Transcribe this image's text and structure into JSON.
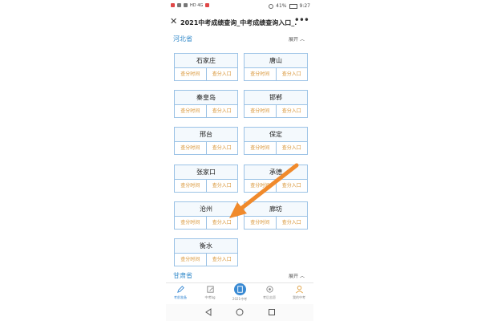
{
  "status_bar": {
    "left_text": "HD 4G",
    "battery": "41%",
    "time": "9:27"
  },
  "titlebar": {
    "title": "2021中考成绩查询_中考成绩查询入口_..."
  },
  "provinces": [
    {
      "name": "河北省",
      "expand_label": "展开",
      "cities": [
        {
          "name": "石家庄",
          "time_label": "查分时间",
          "entry_label": "查分入口"
        },
        {
          "name": "唐山",
          "time_label": "查分时间",
          "entry_label": "查分入口"
        },
        {
          "name": "秦皇岛",
          "time_label": "查分时间",
          "entry_label": "查分入口"
        },
        {
          "name": "邯郸",
          "time_label": "查分时间",
          "entry_label": "查分入口"
        },
        {
          "name": "邢台",
          "time_label": "查分时间",
          "entry_label": "查分入口"
        },
        {
          "name": "保定",
          "time_label": "查分时间",
          "entry_label": "查分入口"
        },
        {
          "name": "张家口",
          "time_label": "查分时间",
          "entry_label": "查分入口"
        },
        {
          "name": "承德",
          "time_label": "查分时间",
          "entry_label": "查分入口"
        },
        {
          "name": "沧州",
          "time_label": "查分时间",
          "entry_label": "查分入口"
        },
        {
          "name": "廊坊",
          "time_label": "查分时间",
          "entry_label": "查分入口"
        },
        {
          "name": "衡水",
          "time_label": "查分时间",
          "entry_label": "查分入口"
        }
      ]
    },
    {
      "name": "甘肃省",
      "expand_label": "展开"
    }
  ],
  "bottom_nav": [
    {
      "label": "考前准备",
      "icon": "pencil-icon"
    },
    {
      "label": "中考bg",
      "icon": "edit-icon"
    },
    {
      "label": "2021中考",
      "icon": "document-icon"
    },
    {
      "label": "考后志愿",
      "icon": "gear-icon"
    },
    {
      "label": "我的中考",
      "icon": "person-icon"
    }
  ],
  "colors": {
    "province": "#2e87c9",
    "card_border": "#9cc3e6",
    "action_text": "#d89434",
    "arrow": "#f08a2c",
    "nav_active": "#3a8ad3"
  }
}
